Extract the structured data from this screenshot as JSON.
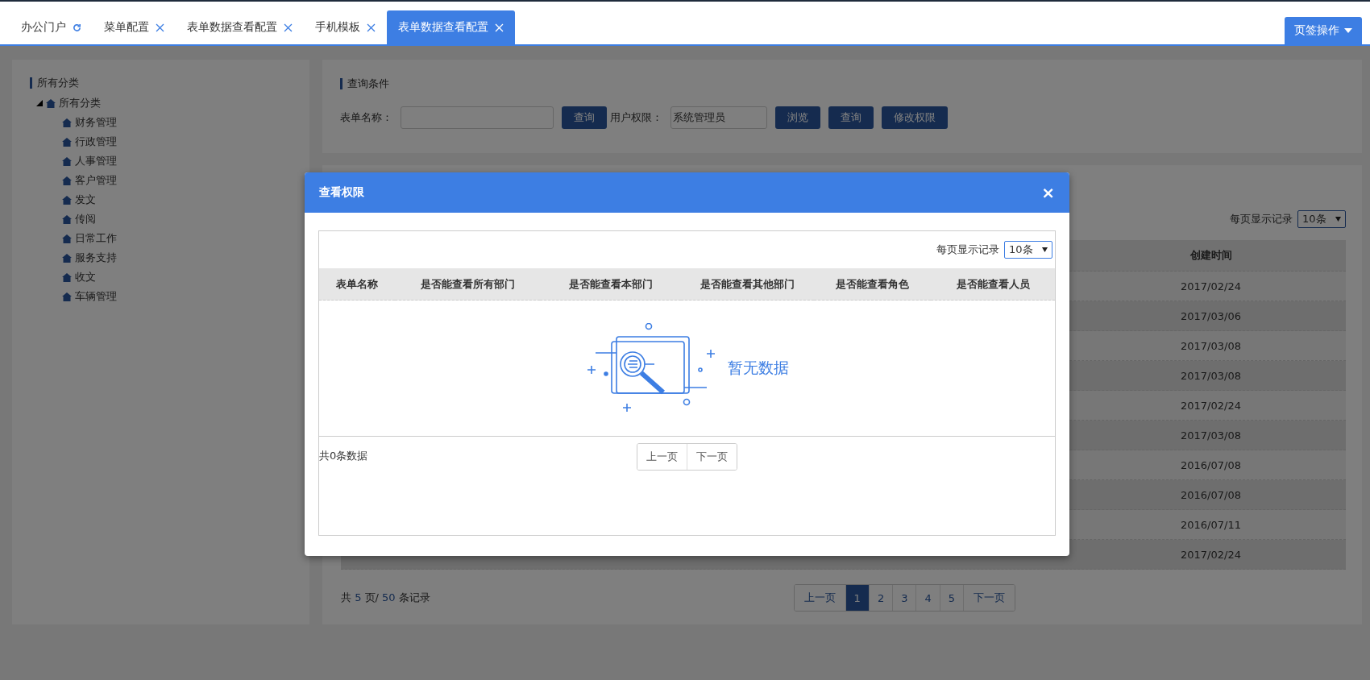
{
  "tabs": [
    {
      "label": "办公门户",
      "kind": "home",
      "selected": false
    },
    {
      "label": "菜单配置",
      "kind": "closable",
      "selected": false
    },
    {
      "label": "表单数据查看配置",
      "kind": "closable",
      "selected": false
    },
    {
      "label": "手机模板",
      "kind": "closable",
      "selected": false
    },
    {
      "label": "表单数据查看配置",
      "kind": "closable",
      "selected": true
    }
  ],
  "tab_actions": {
    "label": "页签操作"
  },
  "sidebar": {
    "title": "所有分类",
    "tree": [
      {
        "label": "所有分类",
        "expanded": true,
        "children": [
          {
            "label": "财务管理"
          },
          {
            "label": "行政管理"
          },
          {
            "label": "人事管理"
          },
          {
            "label": "客户管理"
          },
          {
            "label": "发文"
          },
          {
            "label": "传阅"
          },
          {
            "label": "日常工作"
          },
          {
            "label": "服务支持"
          },
          {
            "label": "收文"
          },
          {
            "label": "车辆管理"
          }
        ]
      }
    ]
  },
  "query": {
    "title": "查询条件",
    "form_name_label": "表单名称：",
    "search_button": "查询",
    "user_permission_label": "用户权限：",
    "user_permission_value": "系统管理员",
    "buttons": [
      "浏览",
      "查询",
      "修改权限"
    ]
  },
  "list": {
    "page_size_label": "每页显示记录",
    "page_size": "10条",
    "columns": [
      "创建时间"
    ],
    "rows": [
      "2017/02/24",
      "2017/03/06",
      "2017/03/08",
      "2017/03/08",
      "2017/02/24",
      "2017/03/08",
      "2016/07/08",
      "2016/07/08",
      "2016/07/11",
      "2017/02/24"
    ],
    "summary": {
      "prefix": "共",
      "pages": "5",
      "middle": "页/",
      "records": "50",
      "suffix": "条记录"
    },
    "pager": [
      {
        "label": "上一页",
        "selected": false
      },
      {
        "label": "1",
        "selected": true
      },
      {
        "label": "2",
        "selected": false
      },
      {
        "label": "3",
        "selected": false
      },
      {
        "label": "4",
        "selected": false
      },
      {
        "label": "5",
        "selected": false
      },
      {
        "label": "下一页",
        "selected": false
      }
    ]
  },
  "dialog": {
    "title": "查看权限",
    "close": "×",
    "page_size_label": "每页显示记录",
    "page_size": "10条",
    "columns": [
      "表单名称",
      "是否能查看所有部门",
      "是否能查看本部门",
      "是否能查看其他部门",
      "是否能查看角色",
      "是否能查看人员"
    ],
    "empty_text": "暂无数据",
    "total": "共0条数据",
    "pager": [
      "上一页",
      "下一页"
    ]
  }
}
